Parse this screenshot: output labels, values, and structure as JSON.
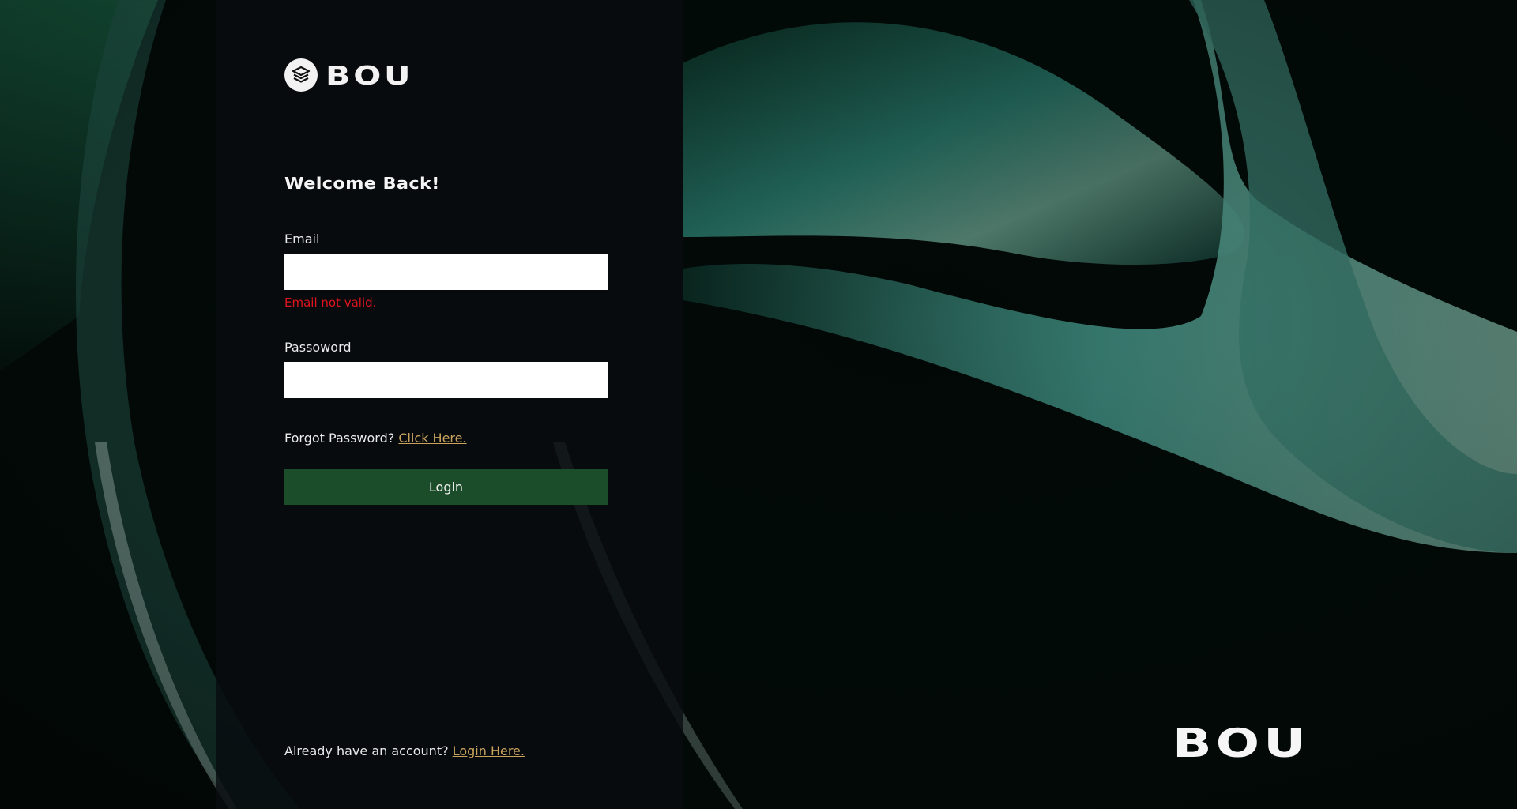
{
  "brand": {
    "logo_text": "BOU",
    "footer_text": "BOU"
  },
  "form": {
    "title": "Welcome Back!",
    "email_label": "Email",
    "email_value": "",
    "email_error": "Email not valid.",
    "password_label": "Passoword",
    "password_value": "",
    "forgot_text": "Forgot Password?",
    "forgot_link": "Click Here.",
    "login_button": "Login",
    "account_text": "Already have an account?",
    "account_link": "Login Here."
  },
  "colors": {
    "panel": "#090c10",
    "accent_button": "#1b4d2b",
    "link": "#c9a35c",
    "error": "#e0141c",
    "background": "#020806"
  },
  "icons": {
    "logo": "stacked-layers-icon"
  }
}
